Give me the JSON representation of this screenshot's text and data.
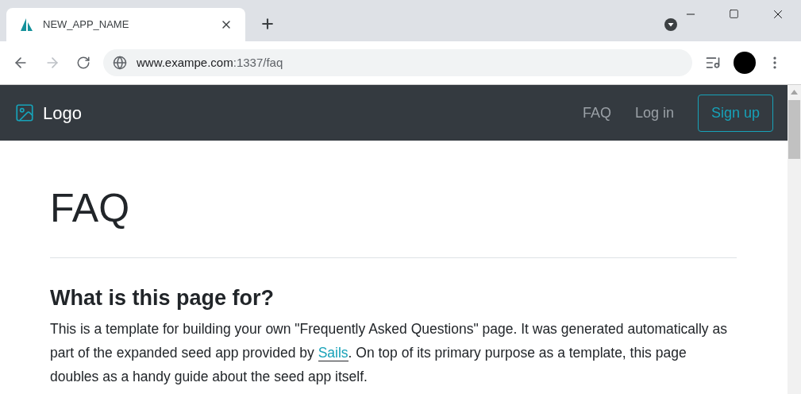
{
  "browser": {
    "tab": {
      "title": "NEW_APP_NAME",
      "selected": true
    },
    "address": {
      "host": "www.exampe.com",
      "rest": ":1337/faq"
    }
  },
  "navbar": {
    "logo": "Logo",
    "links": [
      {
        "label": "FAQ"
      },
      {
        "label": "Log in"
      }
    ],
    "signup": "Sign up"
  },
  "page": {
    "title": "FAQ",
    "sections": [
      {
        "heading": "What is this page for?",
        "paragraph": {
          "before": "This is a template for building your own \"Frequently Asked Questions\" page. It was generated automatically as part of the expanded seed app provided by ",
          "link": "Sails",
          "after": ". On top of its primary purpose as a template, this page doubles as a handy guide about the seed app itself."
        }
      }
    ]
  }
}
